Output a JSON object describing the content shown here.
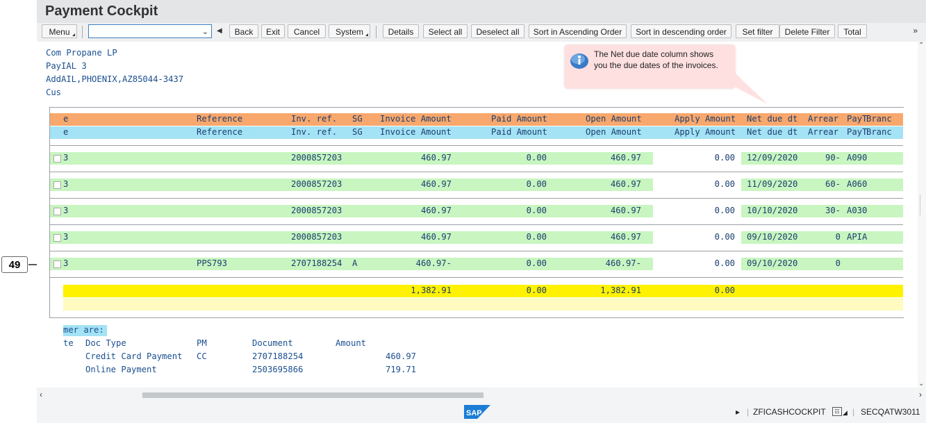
{
  "window": {
    "title": "Payment Cockpit"
  },
  "toolbar": {
    "menu": "Menu",
    "combo_value": "",
    "back": "Back",
    "exit": "Exit",
    "cancel": "Cancel",
    "system": "System",
    "details": "Details",
    "select_all": "Select all",
    "deselect_all": "Deselect all",
    "sort_asc": "Sort in Ascending Order",
    "sort_desc": "Sort in descending order",
    "set_filter": "Set filter",
    "delete_filter": "Delete Filter",
    "total": "Total",
    "more": "»"
  },
  "header_info": [
    "Com Propane LP",
    "PayIAL 3",
    "AddAIL,PHOENIX,AZ85044-3437",
    "Cus"
  ],
  "tooltip": {
    "text": "The Net due date column shows\nyou the due dates of the invoices."
  },
  "table": {
    "columns": [
      "e",
      "Reference",
      "Inv. ref.",
      "SG",
      "Invoice Amount",
      "Paid Amount",
      "Open Amount",
      "Apply Amount",
      "Net due dt",
      "Arrear",
      "PayT",
      "Branc"
    ],
    "rows": [
      {
        "e": "3",
        "reference": "",
        "inv_ref": "2000857203",
        "sg": "",
        "invoice_amount": "460.97",
        "paid_amount": "0.00",
        "open_amount": "460.97",
        "apply_amount": "0.00",
        "net_due_dt": "12/09/2020",
        "arrear": "90-",
        "payt": "A090"
      },
      {
        "e": "3",
        "reference": "",
        "inv_ref": "2000857203",
        "sg": "",
        "invoice_amount": "460.97",
        "paid_amount": "0.00",
        "open_amount": "460.97",
        "apply_amount": "0.00",
        "net_due_dt": "11/09/2020",
        "arrear": "60-",
        "payt": "A060"
      },
      {
        "e": "3",
        "reference": "",
        "inv_ref": "2000857203",
        "sg": "",
        "invoice_amount": "460.97",
        "paid_amount": "0.00",
        "open_amount": "460.97",
        "apply_amount": "0.00",
        "net_due_dt": "10/10/2020",
        "arrear": "30-",
        "payt": "A030"
      },
      {
        "e": "3",
        "reference": "",
        "inv_ref": "2000857203",
        "sg": "",
        "invoice_amount": "460.97",
        "paid_amount": "0.00",
        "open_amount": "460.97",
        "apply_amount": "0.00",
        "net_due_dt": "09/10/2020",
        "arrear": "0",
        "payt": "APIA"
      },
      {
        "e": "3",
        "reference": "PPS793",
        "inv_ref": "2707188254",
        "sg": "A",
        "invoice_amount": "460.97-",
        "paid_amount": "0.00",
        "open_amount": "460.97-",
        "apply_amount": "0.00",
        "net_due_dt": "09/10/2020",
        "arrear": "0",
        "payt": ""
      }
    ],
    "totals": {
      "invoice_amount": "1,382.91",
      "paid_amount": "0.00",
      "open_amount": "1,382.91",
      "apply_amount": "0.00"
    }
  },
  "payments": {
    "heading": "mer are:",
    "columns": [
      "te",
      "Doc Type",
      "PM",
      "Document",
      "Amount"
    ],
    "rows": [
      {
        "doc_type": "Credit Card Payment",
        "pm": "CC",
        "document": "2707188254",
        "amount": "460.97"
      },
      {
        "doc_type": "Online Payment",
        "pm": "",
        "document": "2503695866",
        "amount": "719.71"
      }
    ]
  },
  "callout": {
    "number": "49"
  },
  "status": {
    "logo": "SAP",
    "transaction": "ZFICASHCOCKPIT",
    "system": "SECQATW3011"
  },
  "colors": {
    "header_orange": "#f8a76d",
    "header_blue": "#a4e2f5",
    "row_green": "#c8f5c0",
    "total_yellow": "#fff200",
    "text_blue": "#1a4f8f"
  }
}
